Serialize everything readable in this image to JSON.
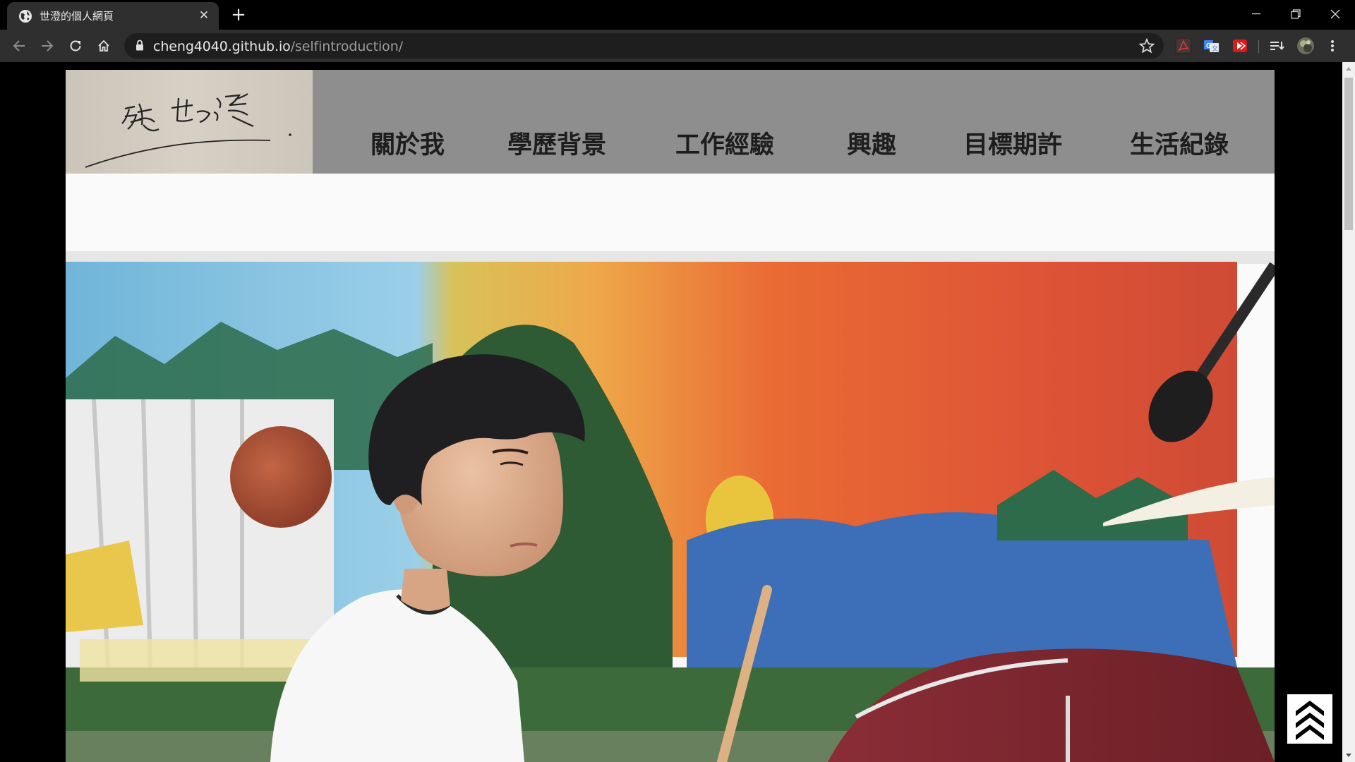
{
  "browser": {
    "tab_title": "世澄的個人網頁",
    "url_host": "cheng4040.github.io",
    "url_path": "/selfintroduction/"
  },
  "site": {
    "logo_alt": "張世澄",
    "nav": [
      "關於我",
      "學歷背景",
      "工作經驗",
      "興趣",
      "目標期許",
      "生活紀錄"
    ]
  },
  "icons": {
    "tab": "globe-icon",
    "back_to_top": "chevron-up-triple-icon",
    "extensions": [
      "pdf-extension-icon",
      "translate-extension-icon",
      "video-extension-icon"
    ]
  },
  "colors": {
    "header_bg": "#8e8e8e",
    "chrome_bg": "#2f2f30",
    "page_bg": "#000000"
  }
}
